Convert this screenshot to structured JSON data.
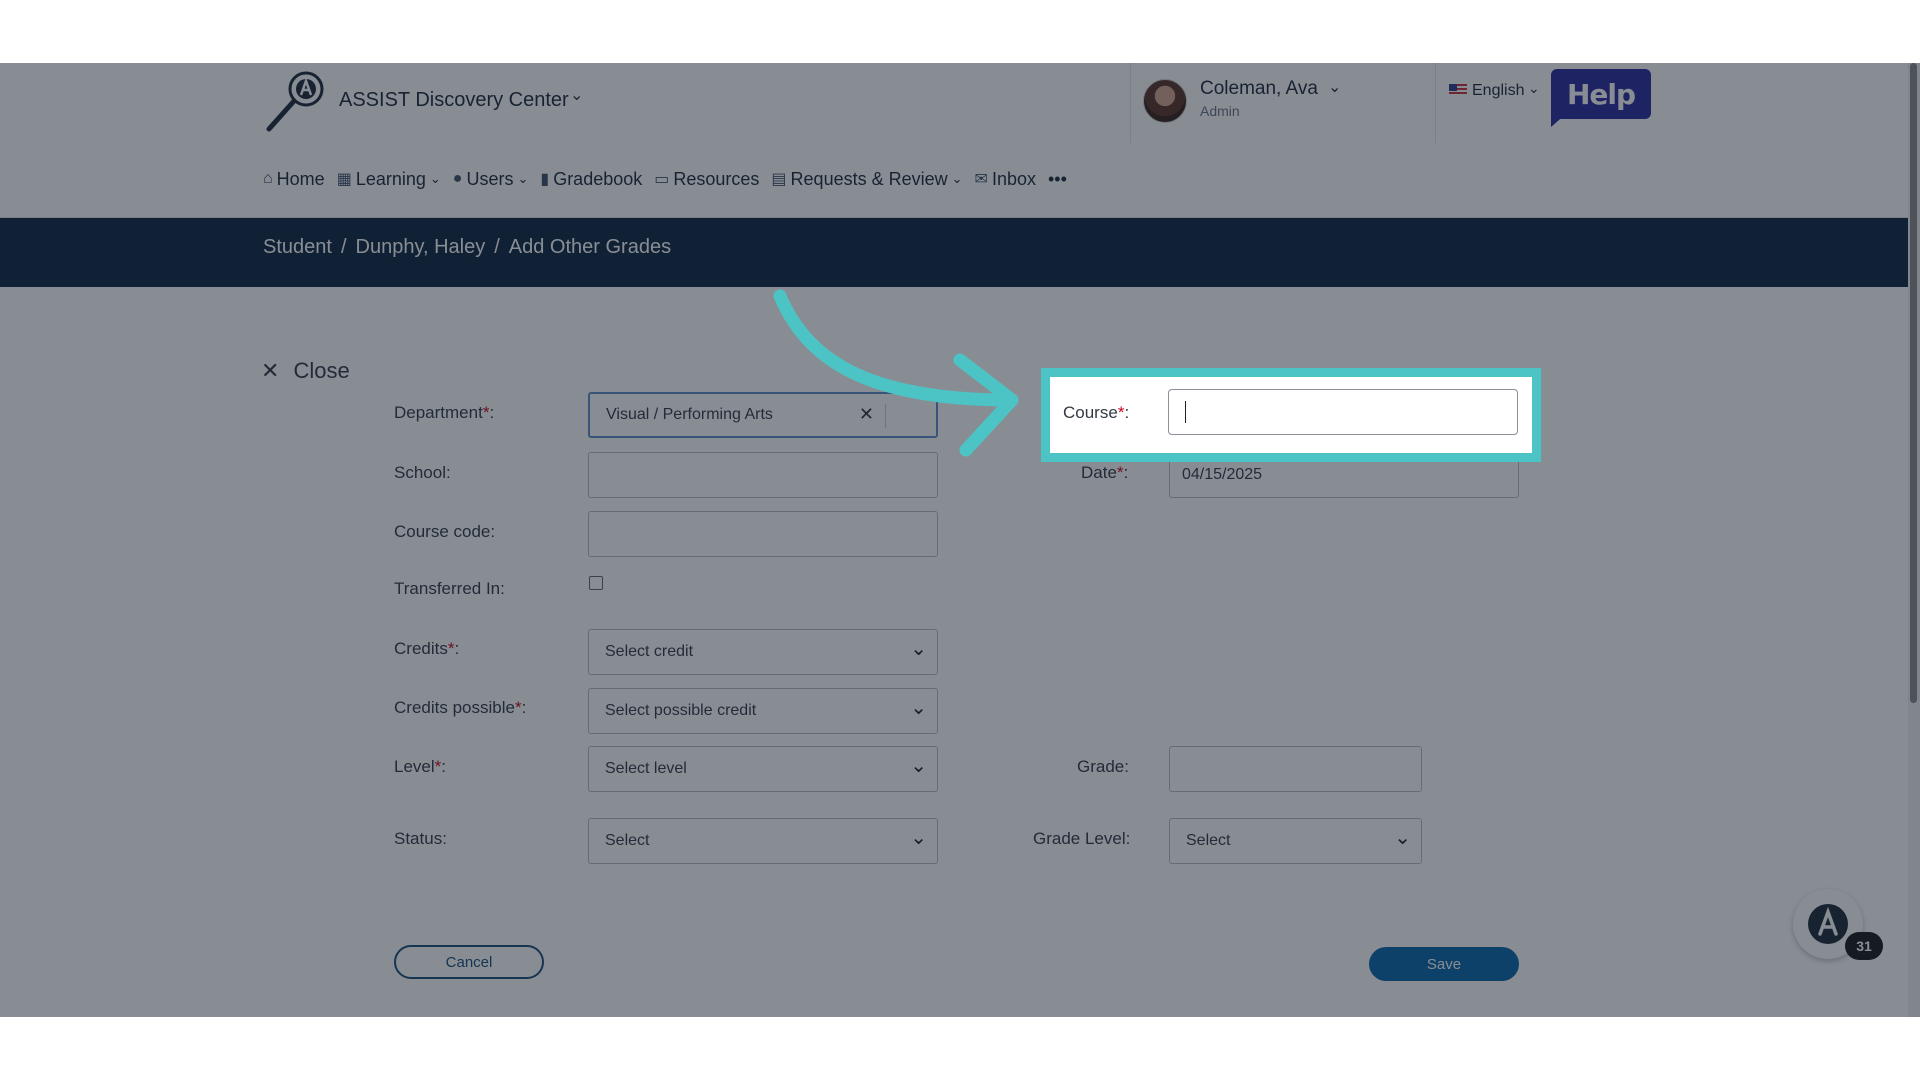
{
  "header": {
    "app_title": "ASSIST Discovery Center",
    "user_name": "Coleman, Ava",
    "user_role": "Admin",
    "language": "English",
    "help_label": "Help"
  },
  "nav": [
    {
      "label": "Home",
      "icon": "home-icon"
    },
    {
      "label": "Learning",
      "icon": "learning-icon",
      "dropdown": true
    },
    {
      "label": "Users",
      "icon": "users-icon",
      "dropdown": true
    },
    {
      "label": "Gradebook",
      "icon": "gradebook-icon"
    },
    {
      "label": "Resources",
      "icon": "resources-icon"
    },
    {
      "label": "Requests & Review",
      "icon": "requests-icon",
      "dropdown": true
    },
    {
      "label": "Inbox",
      "icon": "inbox-icon"
    },
    {
      "label": "•••",
      "icon": "more-icon"
    }
  ],
  "breadcrumb": [
    "Student",
    "/",
    "Dunphy, Haley",
    "/",
    "Add Other Grades"
  ],
  "form": {
    "close_label": "Close",
    "department_label": "Department",
    "department_value": "Visual / Performing Arts",
    "school_label": "School",
    "course_code_label": "Course code",
    "transferred_label": "Transferred In",
    "credits_label": "Credits",
    "credits_placeholder": "Select credit",
    "credits_possible_label": "Credits possible",
    "credits_possible_placeholder": "Select possible credit",
    "level_label": "Level",
    "level_placeholder": "Select level",
    "status_label": "Status",
    "status_placeholder": "Select",
    "course_label": "Course",
    "course_value": "",
    "date_label": "Date",
    "date_value": "04/15/2025",
    "grade_label": "Grade",
    "grade_level_label": "Grade Level",
    "grade_level_placeholder": "Select",
    "required_mark": "*",
    "colon": ":",
    "cancel_label": "Cancel",
    "save_label": "Save"
  },
  "chat_badge": "31",
  "colors": {
    "highlight": "#4cc3c5",
    "breadcrumb_bar": "#0f2640",
    "save": "#0b66a8",
    "help": "#2a2a9e"
  }
}
